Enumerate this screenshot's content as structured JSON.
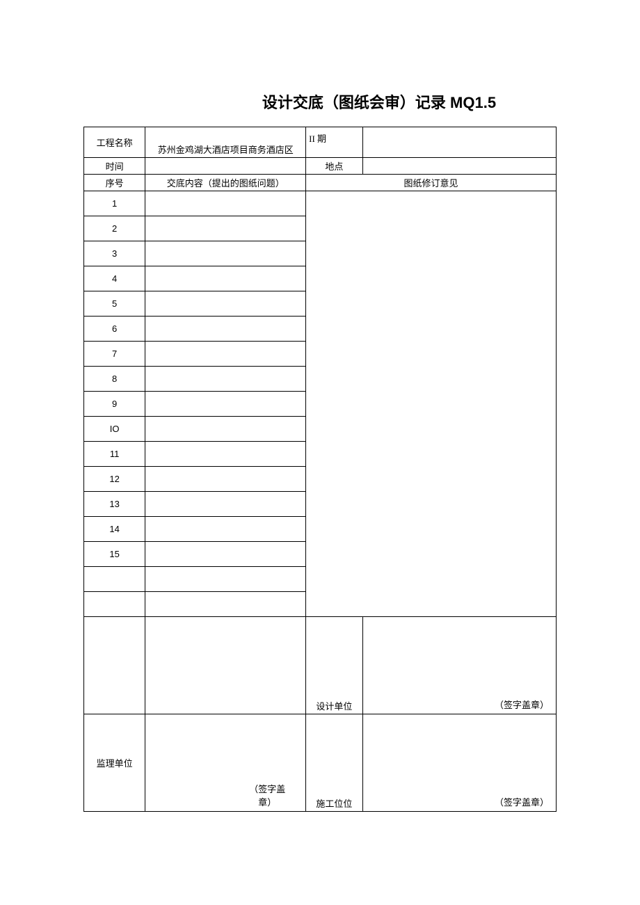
{
  "title": "设计交底（图纸会审）记录 MQ1.5",
  "labels": {
    "project_name": "工程名称",
    "project_name_value": "苏州金鸡湖大酒店项目商务酒店区",
    "phase": "II 期",
    "time": "时间",
    "location": "地点",
    "seq_header": "序号",
    "content_header": "交底内容（提出的图纸问题）",
    "revision_header": "图纸修订意见",
    "design_unit": "设计单位",
    "supervision_unit": "监理单位",
    "construction_unit": "施工位位",
    "signature": "（签字盖章）",
    "signature_split": "（签字盖\n章）"
  },
  "rows": [
    "1",
    "2",
    "3",
    "4",
    "5",
    "6",
    "7",
    "8",
    "9",
    "IO",
    "11",
    "12",
    "13",
    "14",
    "15"
  ]
}
